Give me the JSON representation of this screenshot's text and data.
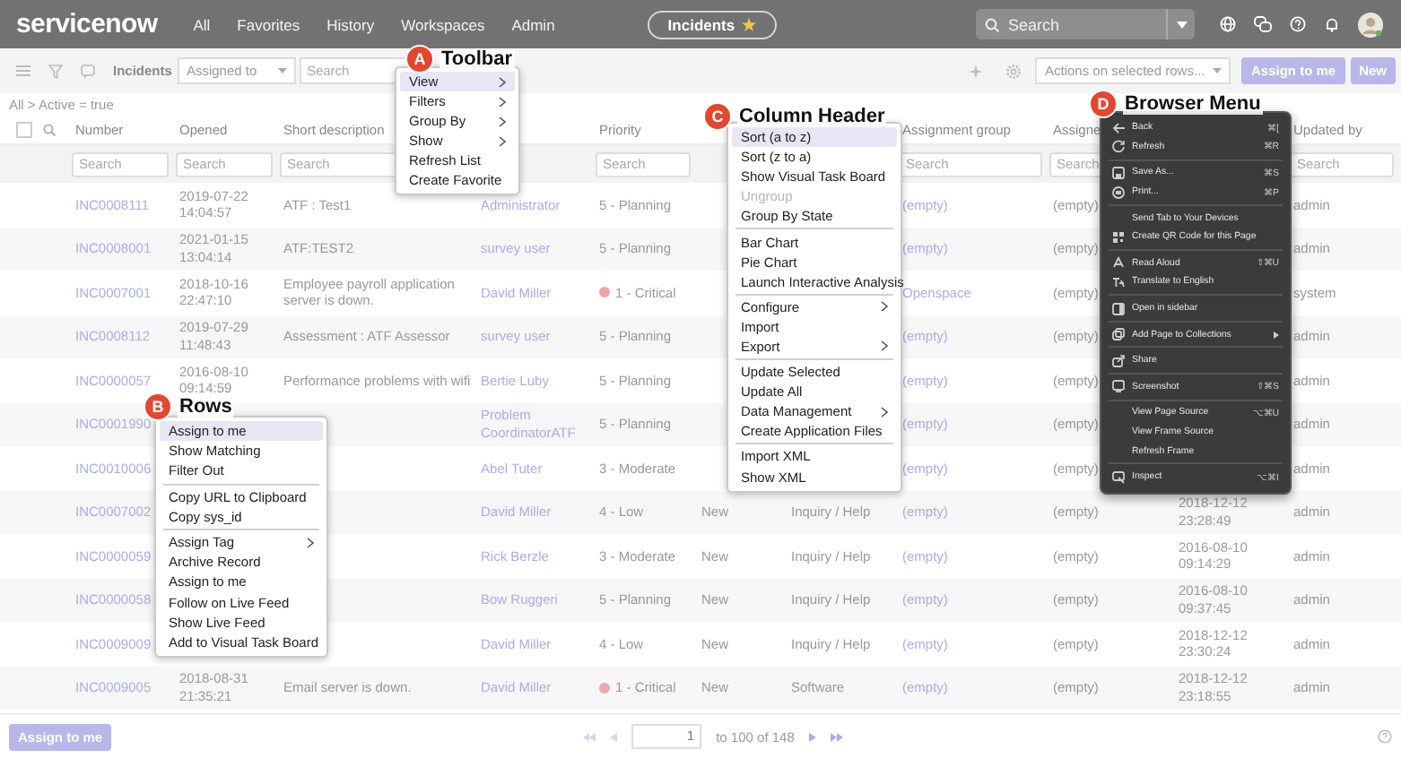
{
  "nav": {
    "logo": "servicenow",
    "items": [
      "All",
      "Favorites",
      "History",
      "Workspaces",
      "Admin"
    ],
    "pill": {
      "label": "Incidents",
      "star": "★"
    },
    "search": {
      "placeholder": "Search"
    }
  },
  "toolbar": {
    "title": "Incidents",
    "filter_select": "Assigned to",
    "search": {
      "placeholder": "Search"
    },
    "actions_select": "Actions on selected rows...",
    "buttons": [
      "Assign to me",
      "New"
    ]
  },
  "breadcrumb": "All > Active = true",
  "table": {
    "select_all": {
      "checked": false
    },
    "columns": {
      "number": {
        "label": "Number",
        "search": "Search"
      },
      "opened": {
        "label": "Opened",
        "search": "Search"
      },
      "short_description": {
        "label": "Short description",
        "search": "Search"
      },
      "priority": {
        "label": "Priority",
        "search": "Search"
      },
      "assignment_group": {
        "label": "Assignment group",
        "search": "Search"
      },
      "assigned_to": {
        "label": "Assigne",
        "search": "Search"
      },
      "updated_by": {
        "label": "Updated by",
        "search": "Search"
      }
    },
    "rows": [
      {
        "number": "INC0008111",
        "opened": "2019-07-22 14:04:57",
        "short_description": "ATF : Test1",
        "caller": "Administrator",
        "priority": "5 - Planning",
        "assignment_group": "(empty)",
        "assigned_to": "(empty)",
        "updated_by": "admin"
      },
      {
        "number": "INC0008001",
        "opened": "2021-01-15 13:04:14",
        "short_description": "ATF:TEST2",
        "caller": "survey user",
        "priority": "5 - Planning",
        "assignment_group": "(empty)",
        "assigned_to": "(empty)",
        "updated_by": "admin"
      },
      {
        "number": "INC0007001",
        "opened": "2018-10-16 22:47:10",
        "short_description": "Employee payroll application server is down.",
        "caller": "David Miller",
        "priority": "1 - Critical",
        "color": "#f3a4a8",
        "assignment_group": "Openspace",
        "assigned_to": "(empty)",
        "updated_by": "system"
      },
      {
        "number": "INC0008112",
        "opened": "2019-07-29 11:48:43",
        "short_description": "Assessment : ATF Assessor",
        "caller": "survey user",
        "priority": "5 - Planning",
        "assignment_group": "(empty)",
        "assigned_to": "(empty)",
        "updated_by": "admin"
      },
      {
        "number": "INC0000057",
        "opened": "2016-08-10 09:14:59",
        "short_description": "Performance problems with wifi",
        "caller": "Bertie Luby",
        "priority": "5 - Planning",
        "assignment_group": "(empty)",
        "assigned_to": "(empty)",
        "updated_by": "admin"
      },
      {
        "number": "INC0001990",
        "caller": "Problem CoordinatorATF",
        "priority": "5 - Planning",
        "assignment_group": "(empty)",
        "assigned_to": "(empty)",
        "updated_by": "admin"
      },
      {
        "number": "INC0010006",
        "caller": "Abel Tuter",
        "priority": "3 - Moderate",
        "assignment_group": "(empty)",
        "assigned_to": "(empty)",
        "updated_by": "admin"
      },
      {
        "number": "INC0007002",
        "caller": "David Miller",
        "priority": "4 - Low",
        "state": "New",
        "category": "Inquiry / Help",
        "assignment_group": "(empty)",
        "assigned_to": "(empty)",
        "updated": "2018-12-12 23:28:49",
        "updated_by": "admin"
      },
      {
        "number": "INC0000059",
        "caller": "Rick Berzle",
        "priority": "3 - Moderate",
        "state": "New",
        "category": "Inquiry / Help",
        "assignment_group": "(empty)",
        "assigned_to": "(empty)",
        "updated": "2016-08-10 09:14:29",
        "updated_by": "admin"
      },
      {
        "number": "INC0000058",
        "caller": "Bow Ruggeri",
        "priority": "5 - Planning",
        "state": "New",
        "category": "Inquiry / Help",
        "assignment_group": "(empty)",
        "assigned_to": "(empty)",
        "updated": "2016-08-10 09:37:45",
        "updated_by": "admin"
      },
      {
        "number": "INC0009009",
        "caller": "David Miller",
        "priority": "4 - Low",
        "state": "New",
        "category": "Inquiry / Help",
        "assignment_group": "(empty)",
        "assigned_to": "(empty)",
        "updated": "2018-12-12 23:30:24",
        "updated_by": "admin"
      },
      {
        "number": "INC0009005",
        "opened": "2018-08-31 21:35:21",
        "short_description": "Email server is down.",
        "caller": "David Miller",
        "priority": "1 - Critical",
        "color": "#f3a4a8",
        "state": "New",
        "category": "Software",
        "assignment_group": "(empty)",
        "assigned_to": "(empty)",
        "updated": "2018-12-12 23:18:55",
        "updated_by": "admin"
      }
    ]
  },
  "footer": {
    "button": "Assign to me",
    "page": "1",
    "range": "to 100 of 148"
  },
  "callouts": [
    {
      "letter": "A",
      "title": "Toolbar"
    },
    {
      "letter": "B",
      "title": "Rows"
    },
    {
      "letter": "C",
      "title": "Column Header"
    },
    {
      "letter": "D",
      "title": "Browser Menu"
    }
  ],
  "menus": [
    {
      "kind": "dropdown",
      "items": [
        {
          "kind": "item",
          "label": "View",
          "submenu": true,
          "selected": true
        },
        {
          "kind": "item",
          "label": "Filters",
          "submenu": true,
          "selected": false
        },
        {
          "kind": "item",
          "label": "Group By",
          "submenu": true,
          "selected": false
        },
        {
          "kind": "item",
          "label": "Show",
          "submenu": true,
          "selected": false
        },
        {
          "kind": "item",
          "label": "Refresh List",
          "submenu": false,
          "selected": false
        },
        {
          "kind": "item",
          "label": "Create Favorite",
          "submenu": false,
          "selected": false
        }
      ]
    },
    {
      "kind": "dropdown",
      "items": [
        {
          "kind": "item",
          "label": "Assign to me",
          "submenu": false,
          "selected": true
        },
        {
          "kind": "item",
          "label": "Show Matching",
          "submenu": false,
          "selected": false
        },
        {
          "kind": "item",
          "label": "Filter Out",
          "submenu": false,
          "selected": false
        },
        {
          "kind": "separator"
        },
        {
          "kind": "item",
          "label": "Copy URL to Clipboard",
          "submenu": false,
          "selected": false
        },
        {
          "kind": "item",
          "label": "Copy sys_id",
          "submenu": false,
          "selected": false
        },
        {
          "kind": "separator"
        },
        {
          "kind": "item",
          "label": "Assign Tag",
          "submenu": true,
          "selected": false
        },
        {
          "kind": "item",
          "label": "Archive Record",
          "submenu": false,
          "selected": false
        },
        {
          "kind": "item",
          "label": "Assign to me",
          "submenu": false,
          "selected": false
        },
        {
          "kind": "item",
          "label": "Follow on Live Feed",
          "submenu": false,
          "selected": false
        },
        {
          "kind": "item",
          "label": "Show Live Feed",
          "submenu": false,
          "selected": false
        },
        {
          "kind": "item",
          "label": "Add to Visual Task Board",
          "submenu": false,
          "selected": false
        }
      ]
    },
    {
      "kind": "dropdown",
      "items": [
        {
          "kind": "item",
          "label": "Sort (a to z)",
          "submenu": false,
          "selected": true,
          "disabled": false
        },
        {
          "kind": "item",
          "label": "Sort (z to a)",
          "submenu": false,
          "selected": false,
          "disabled": false
        },
        {
          "kind": "item",
          "label": "Show Visual Task Board",
          "submenu": false,
          "selected": false,
          "disabled": false
        },
        {
          "kind": "item",
          "label": "Ungroup",
          "submenu": false,
          "selected": false,
          "disabled": true
        },
        {
          "kind": "item",
          "label": "Group By State",
          "submenu": false,
          "selected": false,
          "disabled": false
        },
        {
          "kind": "separator"
        },
        {
          "kind": "item",
          "label": "Bar Chart",
          "submenu": false,
          "selected": false,
          "disabled": false
        },
        {
          "kind": "item",
          "label": "Pie Chart",
          "submenu": false,
          "selected": false,
          "disabled": false
        },
        {
          "kind": "item",
          "label": "Launch Interactive Analysis",
          "submenu": false,
          "selected": false,
          "disabled": false
        },
        {
          "kind": "separator"
        },
        {
          "kind": "item",
          "label": "Configure",
          "submenu": true,
          "selected": false,
          "disabled": false
        },
        {
          "kind": "item",
          "label": "Import",
          "submenu": false,
          "selected": false,
          "disabled": false
        },
        {
          "kind": "item",
          "label": "Export",
          "submenu": true,
          "selected": false,
          "disabled": false
        },
        {
          "kind": "separator"
        },
        {
          "kind": "item",
          "label": "Update Selected",
          "submenu": false,
          "selected": false,
          "disabled": false
        },
        {
          "kind": "item",
          "label": "Update All",
          "submenu": false,
          "selected": false,
          "disabled": false
        },
        {
          "kind": "item",
          "label": "Data Management",
          "submenu": true,
          "selected": false,
          "disabled": false
        },
        {
          "kind": "item",
          "label": "Create Application Files",
          "submenu": false,
          "selected": false,
          "disabled": false
        },
        {
          "kind": "separator"
        },
        {
          "kind": "item",
          "label": "Import XML",
          "submenu": false,
          "selected": false,
          "disabled": false
        },
        {
          "kind": "item",
          "label": "Show XML",
          "submenu": false,
          "selected": false,
          "disabled": false
        }
      ]
    },
    {
      "kind": "browser",
      "items": [
        {
          "kind": "item",
          "label": "Back",
          "shortcut": "⌘[",
          "submenu": false
        },
        {
          "kind": "item",
          "label": "Refresh",
          "shortcut": "⌘R",
          "submenu": false
        },
        {
          "kind": "separator"
        },
        {
          "kind": "item",
          "label": "Save As...",
          "shortcut": "⌘S",
          "submenu": false
        },
        {
          "kind": "item",
          "label": "Print...",
          "shortcut": "⌘P",
          "submenu": false
        },
        {
          "kind": "separator"
        },
        {
          "kind": "item",
          "label": "Send Tab to Your Devices",
          "submenu": false
        },
        {
          "kind": "item",
          "label": "Create QR Code for this Page",
          "submenu": false
        },
        {
          "kind": "separator"
        },
        {
          "kind": "item",
          "label": "Read Aloud",
          "shortcut": "⇧⌘U",
          "submenu": false
        },
        {
          "kind": "item",
          "label": "Translate to English",
          "submenu": false
        },
        {
          "kind": "separator"
        },
        {
          "kind": "item",
          "label": "Open in sidebar",
          "submenu": false
        },
        {
          "kind": "separator"
        },
        {
          "kind": "item",
          "label": "Add Page to Collections",
          "submenu": true
        },
        {
          "kind": "separator"
        },
        {
          "kind": "item",
          "label": "Share",
          "submenu": false
        },
        {
          "kind": "separator"
        },
        {
          "kind": "item",
          "label": "Screenshot",
          "shortcut": "⇧⌘S",
          "submenu": false
        },
        {
          "kind": "separator"
        },
        {
          "kind": "item",
          "label": "View Page Source",
          "shortcut": "⌥⌘U",
          "submenu": false
        },
        {
          "kind": "item",
          "label": "View Frame Source",
          "submenu": false
        },
        {
          "kind": "item",
          "label": "Refresh Frame",
          "submenu": false
        },
        {
          "kind": "separator"
        },
        {
          "kind": "item",
          "label": "Inspect",
          "shortcut": "⌥⌘I",
          "submenu": false
        }
      ]
    }
  ]
}
